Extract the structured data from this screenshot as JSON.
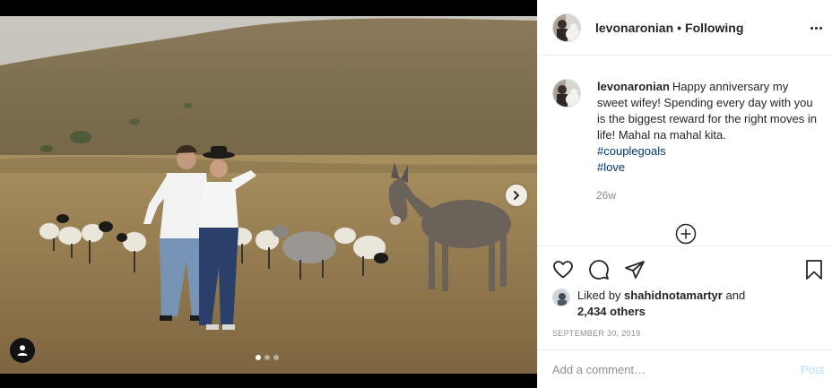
{
  "post": {
    "author": "levonaronian",
    "follow_status": "Following",
    "separator": "•",
    "caption_text": "Happy anniversary my sweet wifey! Spending every day with you is the biggest reward for the right moves in life! Mahal na mahal kita.",
    "hashtags": [
      "#couplegoals",
      "#love"
    ],
    "age": "26w",
    "liked_by_prefix": "Liked by",
    "liked_by_user": "shahidnotamartyr",
    "and_word": "and",
    "others_count": "2,434 others",
    "date": "SEPTEMBER 30, 2019",
    "carousel_count": 3,
    "carousel_active": 0
  },
  "comment": {
    "placeholder": "Add a comment…",
    "post_label": "Post"
  },
  "icons": {
    "more": "more-options-icon",
    "like": "heart-icon",
    "comment": "comment-icon",
    "share": "paper-plane-icon",
    "save": "bookmark-icon",
    "next": "chevron-right-icon",
    "tags": "user-tag-icon",
    "load_more": "plus-circle-icon"
  },
  "colors": {
    "hashtag": "#00376b",
    "muted": "#8e8e8e",
    "post_button_disabled": "#b2dffc"
  }
}
